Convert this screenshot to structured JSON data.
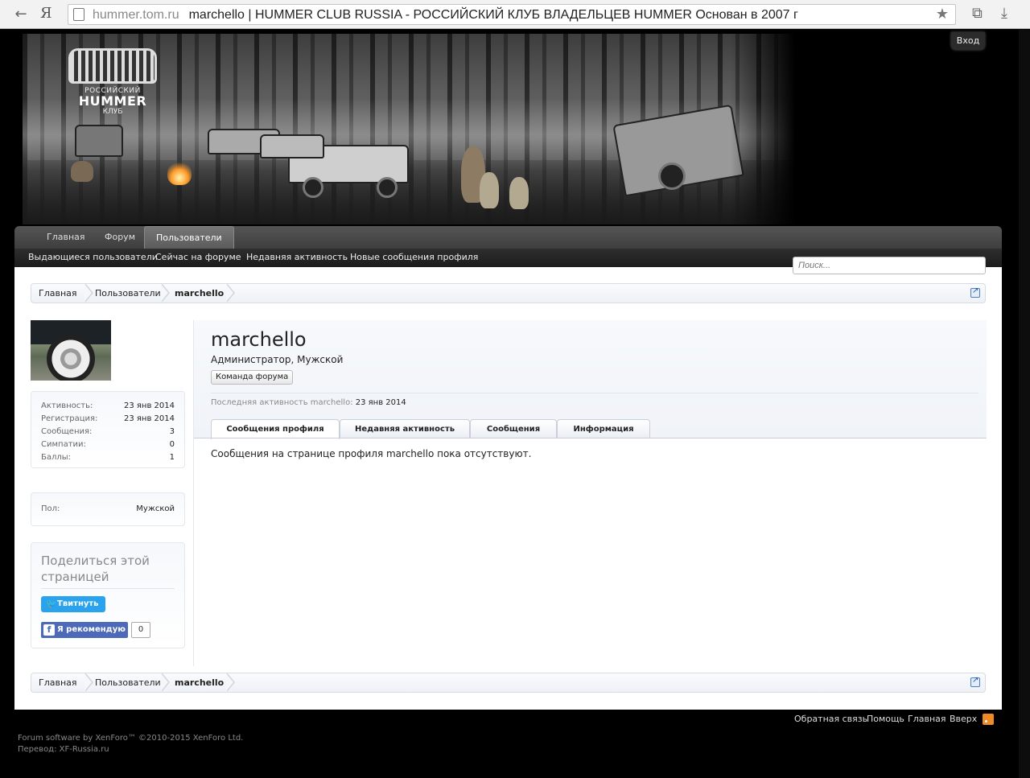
{
  "browser": {
    "ya_logo": "Я",
    "domain": "hummer.tom.ru",
    "title": "marchello | HUMMER CLUB RUSSIA - РОССИЙСКИЙ КЛУБ ВЛАДЕЛЬЦЕВ HUMMER Основан в 2007 г"
  },
  "header": {
    "logo_line1": "РОССИЙСКИЙ",
    "logo_line2": "HUMMER",
    "logo_line3": "КЛУБ",
    "login": "Вход"
  },
  "nav": {
    "tabs": [
      "Главная",
      "Форум",
      "Пользователи"
    ],
    "active_tab": "Пользователи",
    "sub_links": [
      "Выдающиеся пользователи",
      "Сейчас на форуме",
      "Недавняя активность",
      "Новые сообщения профиля"
    ],
    "search_placeholder": "Поиск..."
  },
  "breadcrumb": [
    "Главная",
    "Пользователи",
    "marchello"
  ],
  "profile": {
    "username": "marchello",
    "user_title": "Администратор, Мужской",
    "badge": "Команда форума",
    "last_activity_label": "Последняя активность marchello:",
    "last_activity_value": "23 янв 2014",
    "tabs": [
      "Сообщения профиля",
      "Недавняя активность",
      "Сообщения",
      "Информация"
    ],
    "empty_message": "Сообщения на странице профиля marchello пока отсутствуют."
  },
  "sidebar": {
    "stats": [
      {
        "label": "Активность:",
        "value": "23 янв 2014"
      },
      {
        "label": "Регистрация:",
        "value": "23 янв 2014"
      },
      {
        "label": "Сообщения:",
        "value": "3"
      },
      {
        "label": "Симпатии:",
        "value": "0"
      },
      {
        "label": "Баллы:",
        "value": "1"
      }
    ],
    "gender_label": "Пол:",
    "gender_value": "Мужской",
    "share_title": "Поделиться этой страницей",
    "tweet": "Твитнуть",
    "fb_like": "Я рекомендую",
    "fb_count": "0"
  },
  "footer": {
    "links": [
      "Обратная связь",
      "Помощь",
      "Главная",
      "Вверх"
    ],
    "copyright": "Forum software by XenForo™ ©2010-2015 XenForo Ltd.",
    "translation": "Перевод: XF-Russia.ru"
  },
  "colors": {
    "tweet": "#2aa3ef",
    "facebook": "#4c69ba",
    "rss": "#f08a24"
  }
}
